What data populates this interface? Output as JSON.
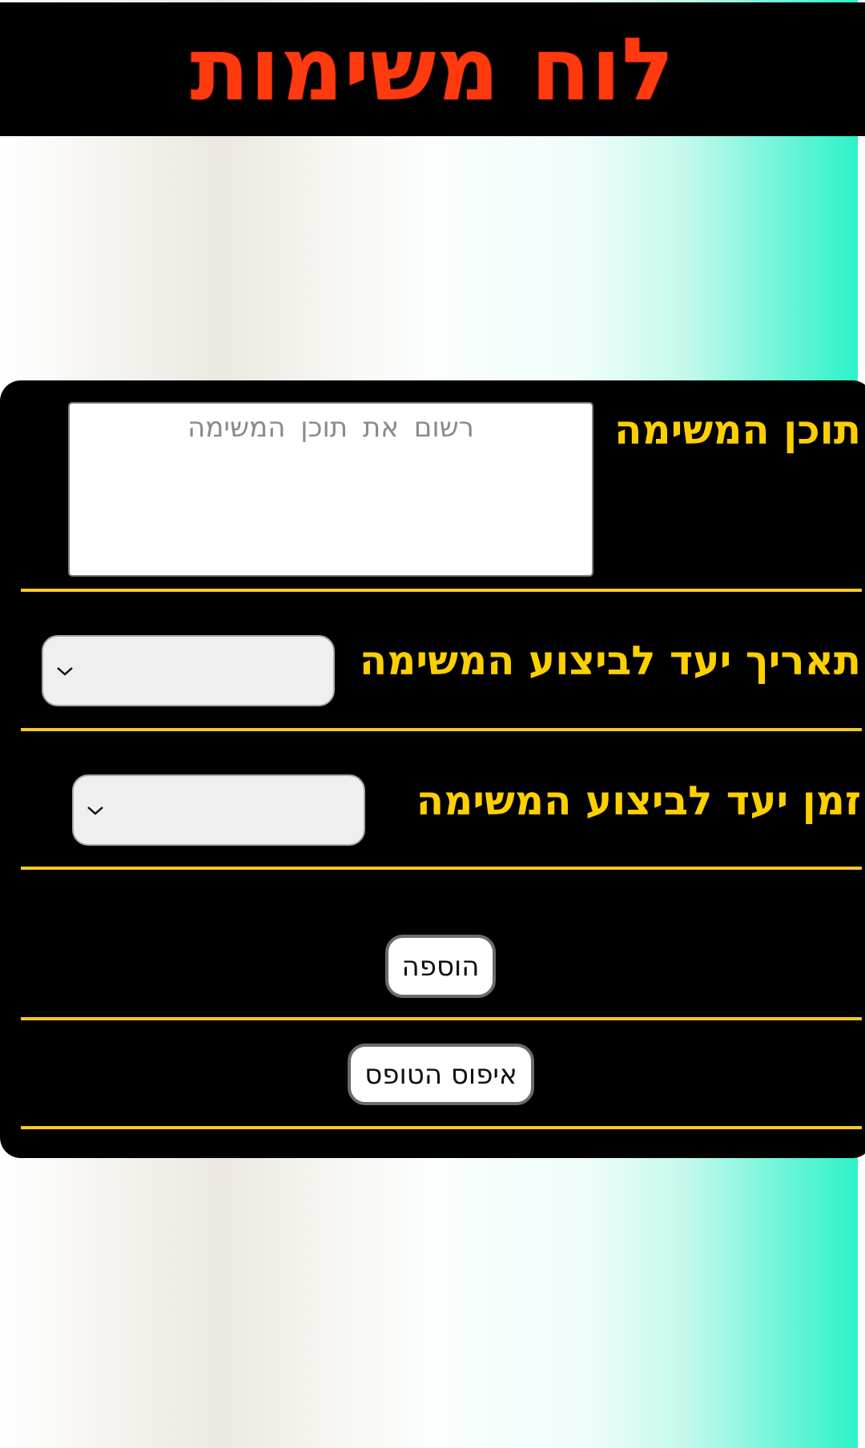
{
  "header": {
    "title": "לוח משימות"
  },
  "form": {
    "task_content": {
      "label": "תוכן המשימה",
      "placeholder": "רשום את תוכן המשימה",
      "value": ""
    },
    "due_date": {
      "label": "תאריך יעד לביצוע המשימה",
      "selected": ""
    },
    "due_time": {
      "label": "זמן יעד לביצוע המשימה",
      "selected": ""
    },
    "add_button_label": "הוספה",
    "reset_button_label": "איפוס הטופס"
  },
  "colors": {
    "title": "#ff3a0e",
    "labels": "#fcd000",
    "dividers": "#f7c923",
    "panel": "#000000",
    "gradient_end": "#2cf2c8"
  },
  "icons": {
    "select_chevron": "chevron-down-icon"
  }
}
